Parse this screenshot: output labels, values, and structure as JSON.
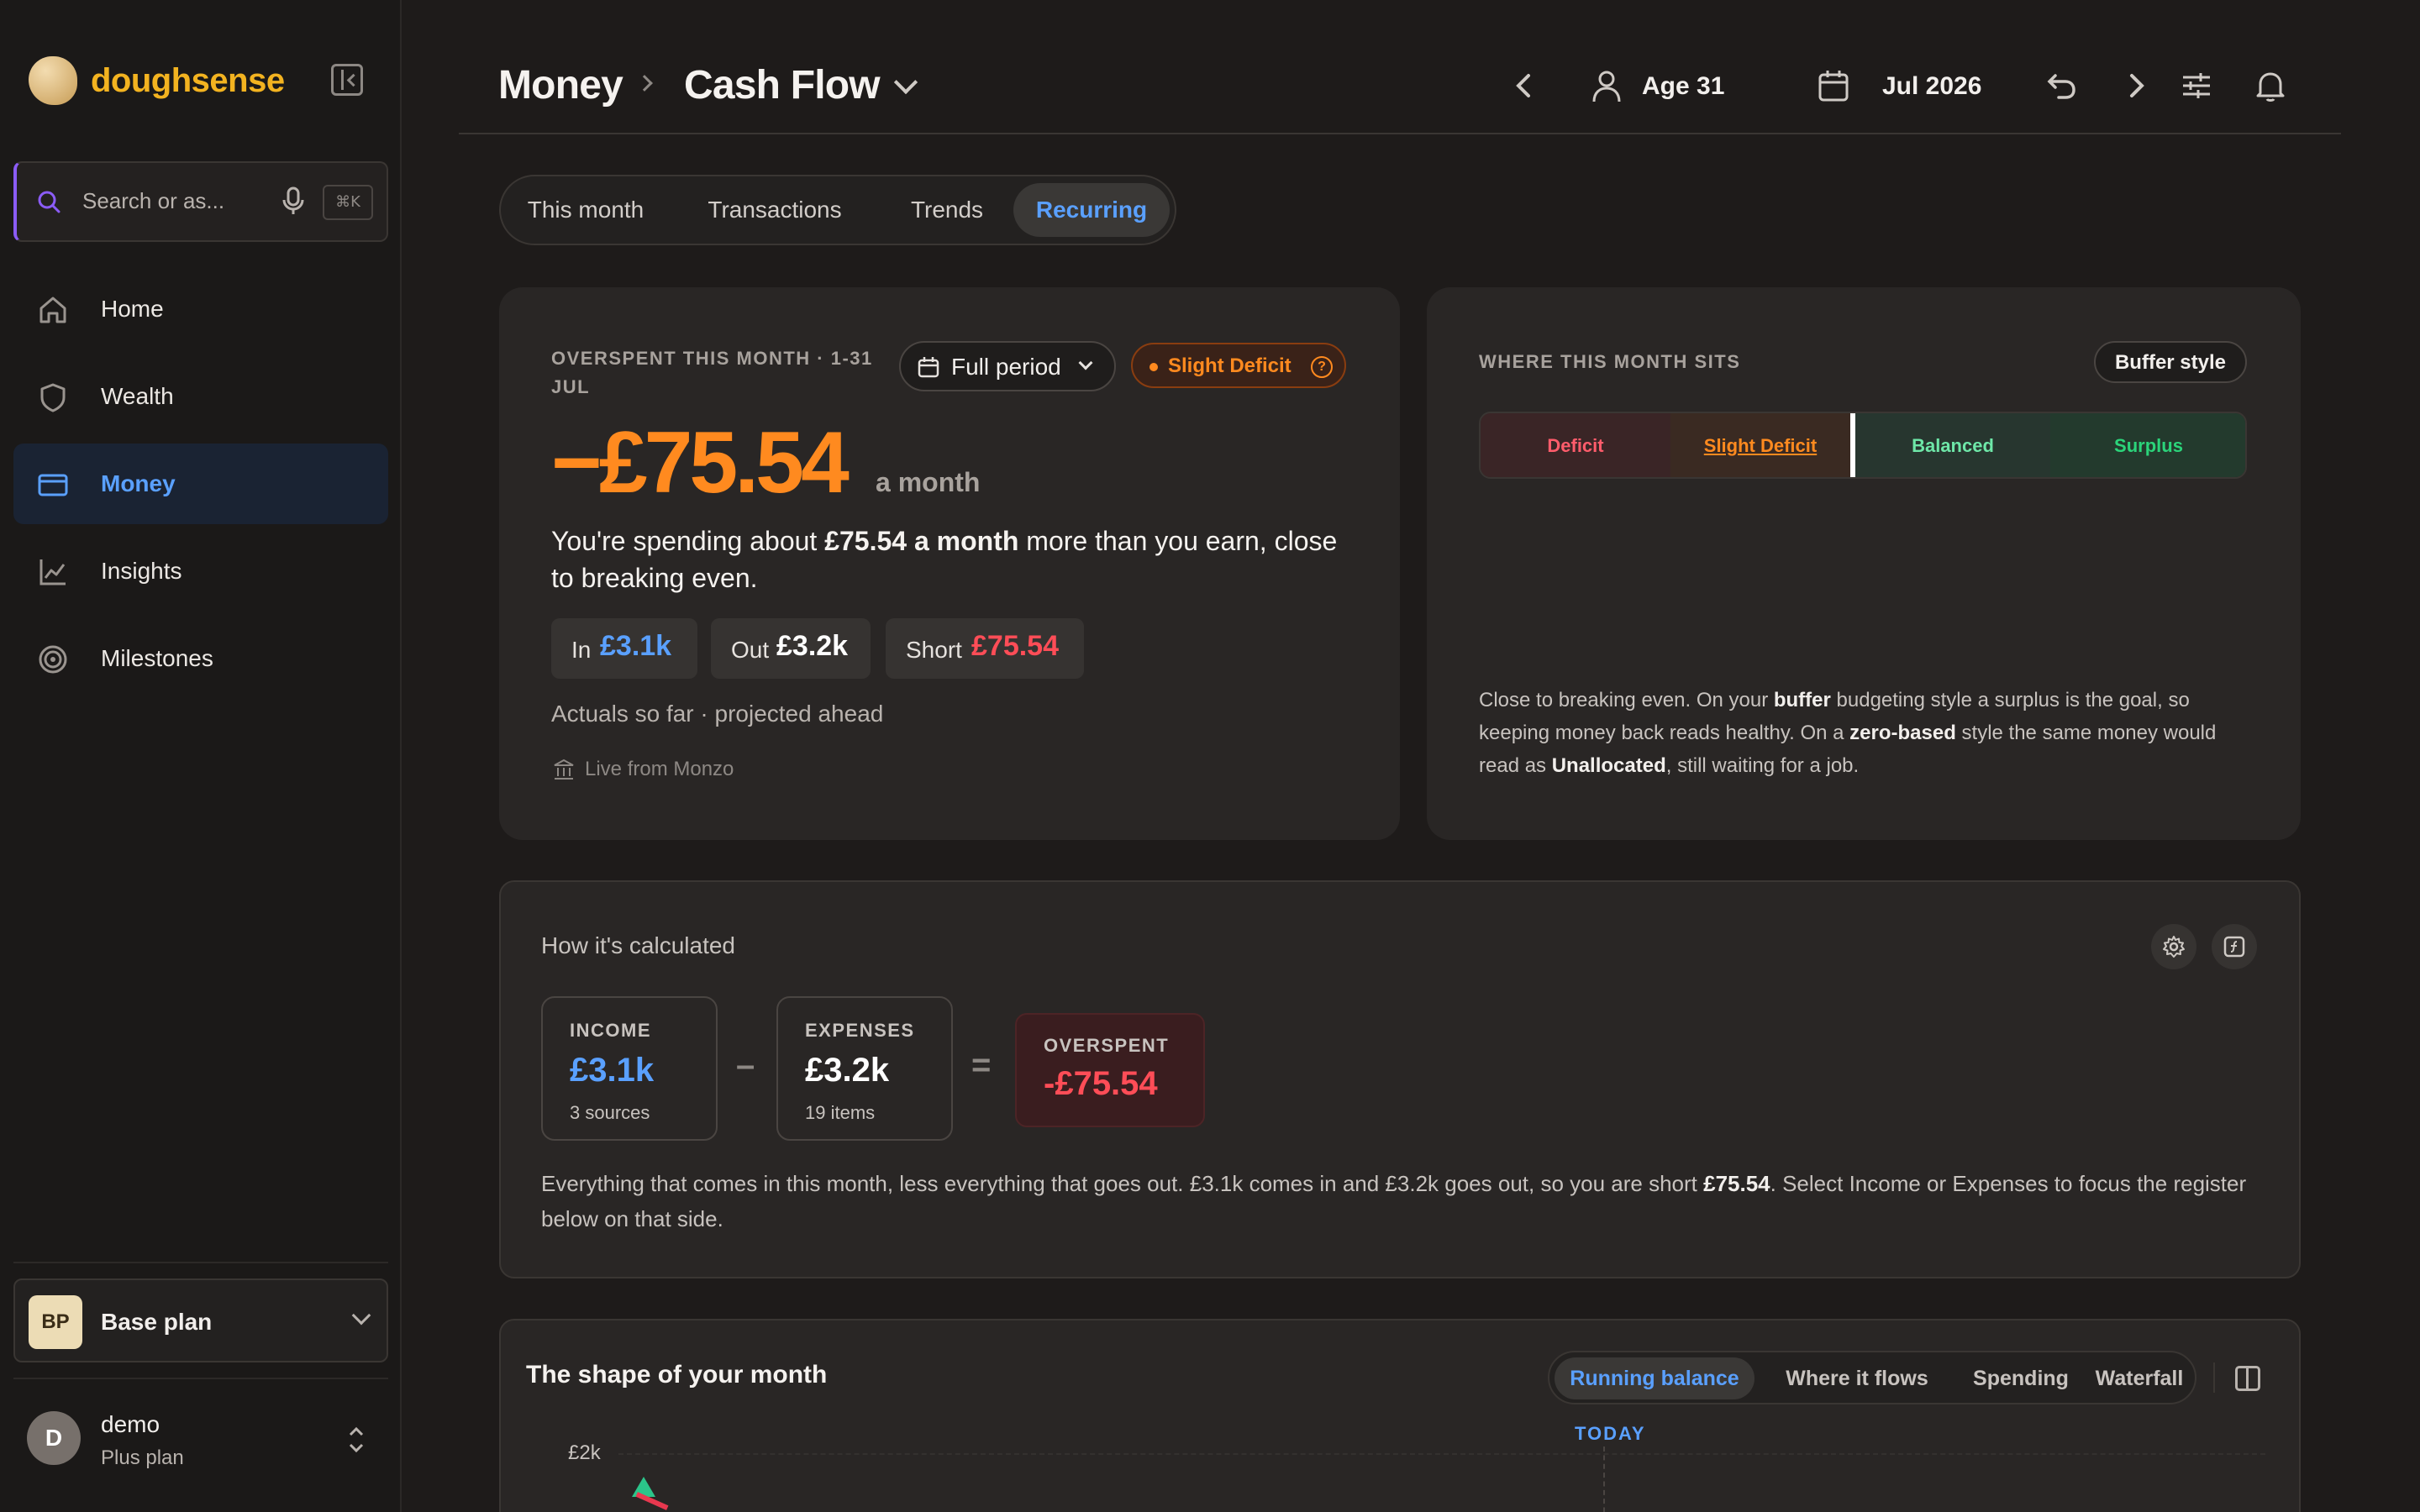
{
  "app": {
    "name": "doughsense"
  },
  "search": {
    "placeholder": "Search or as...",
    "shortcut": "⌘K"
  },
  "sidebar": {
    "items": [
      {
        "label": "Home",
        "icon": "home-icon",
        "active": false
      },
      {
        "label": "Wealth",
        "icon": "shield-icon",
        "active": false
      },
      {
        "label": "Money",
        "icon": "card-icon",
        "active": true
      },
      {
        "label": "Insights",
        "icon": "chart-icon",
        "active": false
      },
      {
        "label": "Milestones",
        "icon": "target-icon",
        "active": false
      }
    ],
    "plan": {
      "badge": "BP",
      "name": "Base plan"
    },
    "user": {
      "initial": "D",
      "name": "demo",
      "plan": "Plus plan"
    }
  },
  "header": {
    "breadcrumb": [
      "Money",
      "Cash Flow"
    ],
    "age": "Age 31",
    "date": "Jul 2026"
  },
  "tabs": [
    "This month",
    "Transactions",
    "Trends",
    "Recurring"
  ],
  "active_tab": "Recurring",
  "overview": {
    "eyebrow_line1": "OVERSPENT THIS MONTH · 1-31",
    "eyebrow_line2": "JUL",
    "period_button": "Full period",
    "status": "Slight Deficit",
    "status_help": "?",
    "amount": "−£75.54",
    "amount_suffix": "a month",
    "summary_pre": "You're spending about ",
    "summary_bold": "£75.54 a month",
    "summary_post": " more than you earn, close to breaking even.",
    "chips": [
      {
        "key": "In",
        "value": "£3.1k",
        "color": "#5aa0ff"
      },
      {
        "key": "Out",
        "value": "£3.2k",
        "color": "#ffffff"
      },
      {
        "key": "Short",
        "value": "£75.54",
        "color": "#ff4d57"
      }
    ],
    "note": "Actuals so far · projected ahead",
    "source": "Live from Monzo"
  },
  "sits": {
    "eyebrow": "WHERE THIS MONTH SITS",
    "style_button": "Buffer style",
    "segments": [
      {
        "label": "Deficit",
        "color": "#ff5c6b"
      },
      {
        "label": "Slight Deficit",
        "color": "#ff8a1f"
      },
      {
        "label": "Balanced",
        "color": "#6ee7a8"
      },
      {
        "label": "Surplus",
        "color": "#2bd47a"
      }
    ],
    "explain": [
      {
        "t": "Close to breaking even. On your ",
        "b": false
      },
      {
        "t": "buffer",
        "b": true
      },
      {
        "t": " budgeting style a surplus is the goal, so keeping money back reads healthy. On a ",
        "b": false
      },
      {
        "t": "zero-based",
        "b": true
      },
      {
        "t": " style the same money would read as ",
        "b": false
      },
      {
        "t": "Unallocated",
        "b": true
      },
      {
        "t": ", still waiting for a job.",
        "b": false
      }
    ]
  },
  "calc": {
    "title": "How it's calculated",
    "income": {
      "label": "INCOME",
      "value": "£3.1k",
      "sub": "3 sources"
    },
    "minus": "–",
    "expenses": {
      "label": "EXPENSES",
      "value": "£3.2k",
      "sub": "19 items"
    },
    "equals": "=",
    "overspent": {
      "label": "OVERSPENT",
      "value": "-£75.54"
    },
    "desc_pre": "Everything that comes in this month, less everything that goes out. £3.1k comes in and £3.2k goes out, so you are short ",
    "desc_bold": "£75.54",
    "desc_post": ". Select Income or Expenses to focus the register below on that side."
  },
  "shape": {
    "title": "The shape of your month",
    "views": [
      "Running balance",
      "Where it flows",
      "Spending",
      "Waterfall"
    ],
    "active_view": "Running balance",
    "y_tick": "£2k",
    "today": "TODAY"
  }
}
